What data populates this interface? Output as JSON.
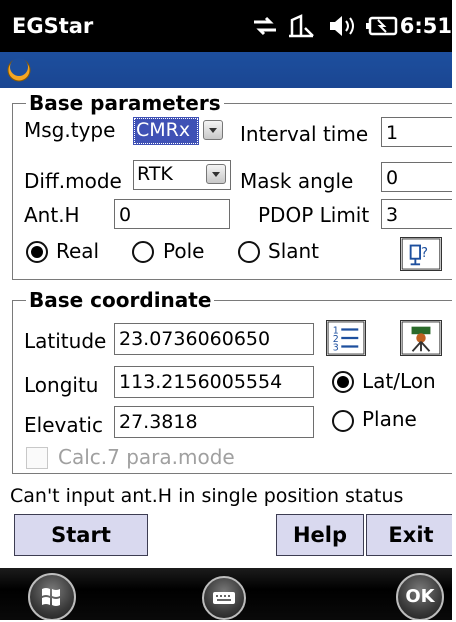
{
  "statusbar": {
    "app_title": "EGStar",
    "clock": "6:51",
    "icons": [
      "network-icon",
      "signal-icon",
      "speaker-icon",
      "battery-icon"
    ]
  },
  "base_parameters": {
    "title": "Base parameters",
    "msg_type_label": "Msg.type",
    "msg_type_value": "CMRx",
    "interval_time_label": "Interval time",
    "interval_time_value": "1",
    "diff_mode_label": "Diff.mode",
    "diff_mode_value": "RTK",
    "mask_angle_label": "Mask angle",
    "mask_angle_value": "0",
    "ant_h_label": "Ant.H",
    "ant_h_value": "0",
    "pdop_limit_label": "PDOP Limit",
    "pdop_limit_value": "3",
    "height_modes": [
      {
        "label": "Real",
        "selected": true
      },
      {
        "label": "Pole",
        "selected": false
      },
      {
        "label": "Slant",
        "selected": false
      }
    ]
  },
  "base_coordinate": {
    "title": "Base coordinate",
    "latitude_label": "Latitude",
    "latitude_value": "23.0736060650",
    "longitude_label": "Longitu",
    "longitude_value": "113.2156005554",
    "elevation_label": "Elevatic",
    "elevation_value": "27.3818",
    "coord_modes": [
      {
        "label": "Lat/Lon",
        "selected": true
      },
      {
        "label": "Plane",
        "selected": false
      }
    ],
    "calc_label": "Calc.7 para.mode",
    "calc_checked": false
  },
  "status_message": "Can't input ant.H in single position status",
  "buttons": {
    "start": "Start",
    "help": "Help",
    "exit": "Exit"
  },
  "taskbar": {
    "ok_label": "OK"
  },
  "colors": {
    "statusbar_bg": "#000000",
    "titlebar_blue": "#1d4f9e",
    "button_bg": "#d9d9ef",
    "combo_highlight": "#3f51b5"
  }
}
